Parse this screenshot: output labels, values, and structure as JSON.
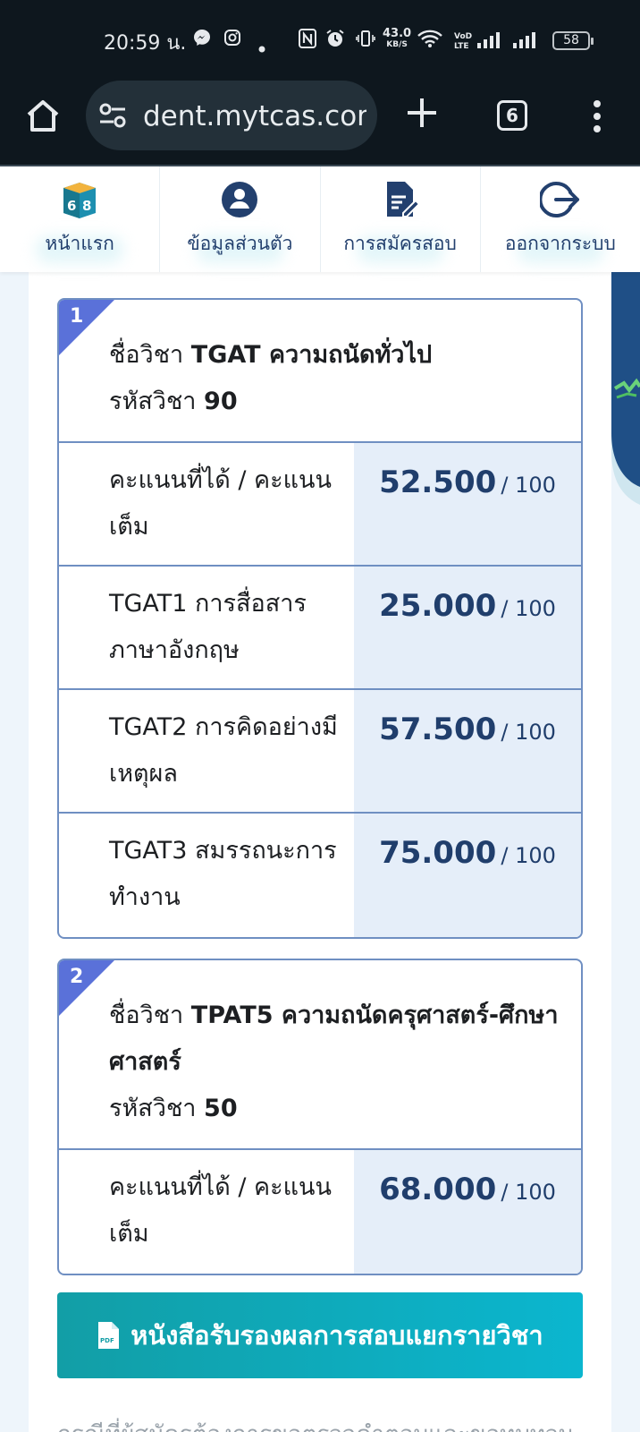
{
  "status_bar": {
    "time": "20:59 น.",
    "net_speed_value": "43.0",
    "net_speed_unit": "KB/S",
    "battery": "58"
  },
  "browser": {
    "url": "dent.mytcas.com",
    "tab_count": "6"
  },
  "nav": {
    "items": [
      {
        "label": "หน้าแรก",
        "icon": "home-logo-icon"
      },
      {
        "label": "ข้อมูลส่วนตัว",
        "icon": "user-circle-icon"
      },
      {
        "label": "การสมัครสอบ",
        "icon": "form-edit-icon"
      },
      {
        "label": "ออกจากระบบ",
        "icon": "logout-icon"
      }
    ]
  },
  "cards": [
    {
      "number": "1",
      "subject_prefix": "ชื่อวิชา",
      "subject_name": "TGAT ความถนัดทั่วไป",
      "code_prefix": "รหัสวิชา",
      "code": "90",
      "rows": [
        {
          "label": "คะแนนที่ได้ / คะแนนเต็ม",
          "score": "52.500",
          "full": "/ 100"
        },
        {
          "label": "TGAT1 การสื่อสารภาษาอังกฤษ",
          "score": "25.000",
          "full": "/ 100"
        },
        {
          "label": "TGAT2 การคิดอย่างมีเหตุผล",
          "score": "57.500",
          "full": "/ 100"
        },
        {
          "label": "TGAT3 สมรรถนะการทำงาน",
          "score": "75.000",
          "full": "/ 100"
        }
      ]
    },
    {
      "number": "2",
      "subject_prefix": "ชื่อวิชา",
      "subject_name": "TPAT5 ความถนัดครุศาสตร์-ศึกษาศาสตร์",
      "code_prefix": "รหัสวิชา",
      "code": "50",
      "rows": [
        {
          "label": "คะแนนที่ได้ / คะแนนเต็ม",
          "score": "68.000",
          "full": "/ 100"
        }
      ]
    }
  ],
  "certificate_button": {
    "label": "หนังสือรับรองผลการสอบแยกรายวิชา",
    "icon_text": "PDF"
  },
  "footnote": "กรณีที่ผู้สมัครต้องการขอตรวจคำตอบและขอทบทวน",
  "colors": {
    "primary_text": "#203e6c",
    "accent_corner": "#5a71d9",
    "button_gradient_start": "#129ea6",
    "button_gradient_end": "#0bb6cf"
  }
}
